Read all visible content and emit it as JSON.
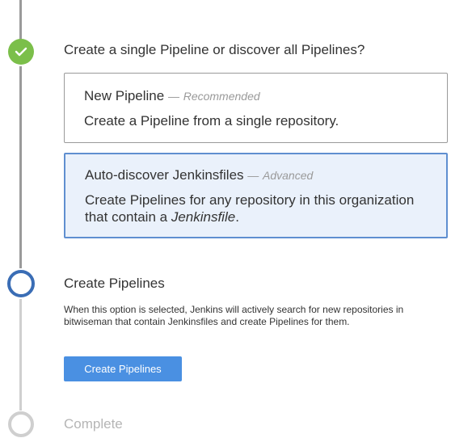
{
  "steps": {
    "discover": {
      "question": "Create a single Pipeline or discover all Pipelines?",
      "options": [
        {
          "title": "New Pipeline",
          "separator": "—",
          "tag": "Recommended",
          "description": "Create a Pipeline from a single repository.",
          "selected": false
        },
        {
          "title": "Auto-discover Jenkinsfiles",
          "separator": "—",
          "tag": "Advanced",
          "description_prefix": "Create Pipelines for any repository in this organization that contain a ",
          "description_emphasis": "Jenkinsfile",
          "description_suffix": ".",
          "selected": true
        }
      ]
    },
    "create": {
      "title": "Create Pipelines",
      "description": "When this option is selected, Jenkins will actively search for new repositories in bitwiseman that contain Jenkinsfiles and create Pipelines for them.",
      "button_label": "Create Pipelines"
    },
    "complete": {
      "title": "Complete"
    }
  },
  "colors": {
    "complete": "#7bbf4a",
    "active": "#3a6db5",
    "pending": "#cfcfcf",
    "selected_bg": "#eaf1fb",
    "selected_border": "#5f8fd0",
    "button": "#4a90e2"
  },
  "icons": {
    "complete_step": "checkmark-icon"
  }
}
